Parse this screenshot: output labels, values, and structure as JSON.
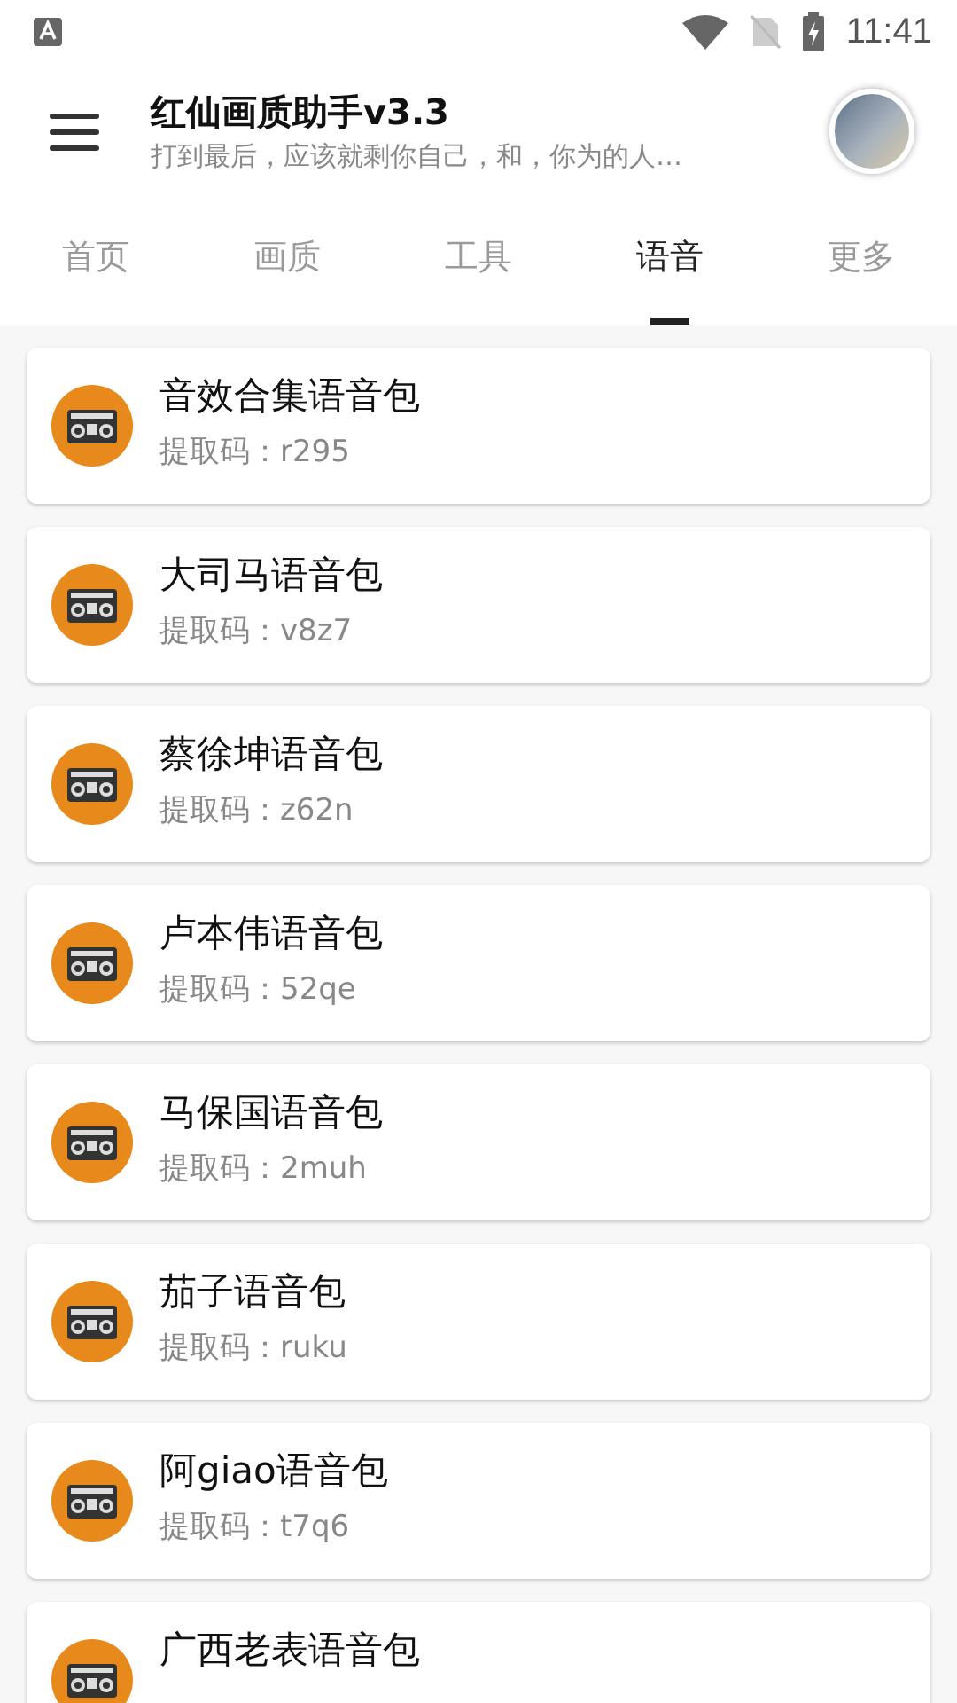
{
  "status_bar": {
    "time": "11:41"
  },
  "app_bar": {
    "title": "红仙画质助手v3.3",
    "subtitle": "打到最后，应该就剩你自己，和，你为的人…"
  },
  "tabs": [
    {
      "label": "首页",
      "selected": false
    },
    {
      "label": "画质",
      "selected": false
    },
    {
      "label": "工具",
      "selected": false
    },
    {
      "label": "语音",
      "selected": true
    },
    {
      "label": "更多",
      "selected": false
    }
  ],
  "items": [
    {
      "title": "音效合集语音包",
      "code": "提取码：r295"
    },
    {
      "title": "大司马语音包",
      "code": "提取码：v8z7"
    },
    {
      "title": "蔡徐坤语音包",
      "code": "提取码：z62n"
    },
    {
      "title": "卢本伟语音包",
      "code": "提取码：52qe"
    },
    {
      "title": "马保国语音包",
      "code": "提取码：2muh"
    },
    {
      "title": "茄子语音包",
      "code": "提取码：ruku"
    },
    {
      "title": "阿giao语音包",
      "code": "提取码：t7q6"
    },
    {
      "title": "广西老表语音包"
    }
  ]
}
